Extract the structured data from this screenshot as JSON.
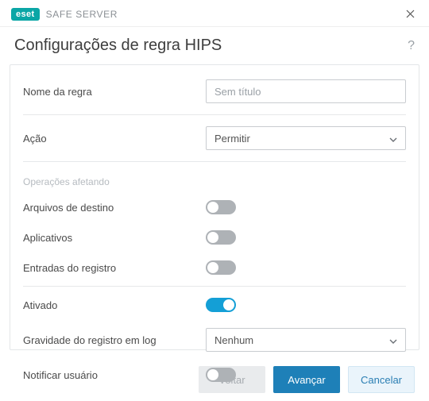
{
  "titlebar": {
    "brand": "eset",
    "product": "SAFE SERVER"
  },
  "header": {
    "title": "Configurações de regra HIPS"
  },
  "form": {
    "rule_name": {
      "label": "Nome da regra",
      "placeholder": "Sem título",
      "value": ""
    },
    "action": {
      "label": "Ação",
      "selected": "Permitir"
    },
    "operations_section": "Operações afetando",
    "target_files": {
      "label": "Arquivos de destino",
      "on": false
    },
    "applications": {
      "label": "Aplicativos",
      "on": false
    },
    "registry_entries": {
      "label": "Entradas do registro",
      "on": false
    },
    "enabled": {
      "label": "Ativado",
      "on": true
    },
    "log_severity": {
      "label": "Gravidade do registro em log",
      "selected": "Nenhum"
    },
    "notify_user": {
      "label": "Notificar usuário",
      "on": false
    }
  },
  "footer": {
    "back": "Voltar",
    "next": "Avançar",
    "cancel": "Cancelar"
  }
}
